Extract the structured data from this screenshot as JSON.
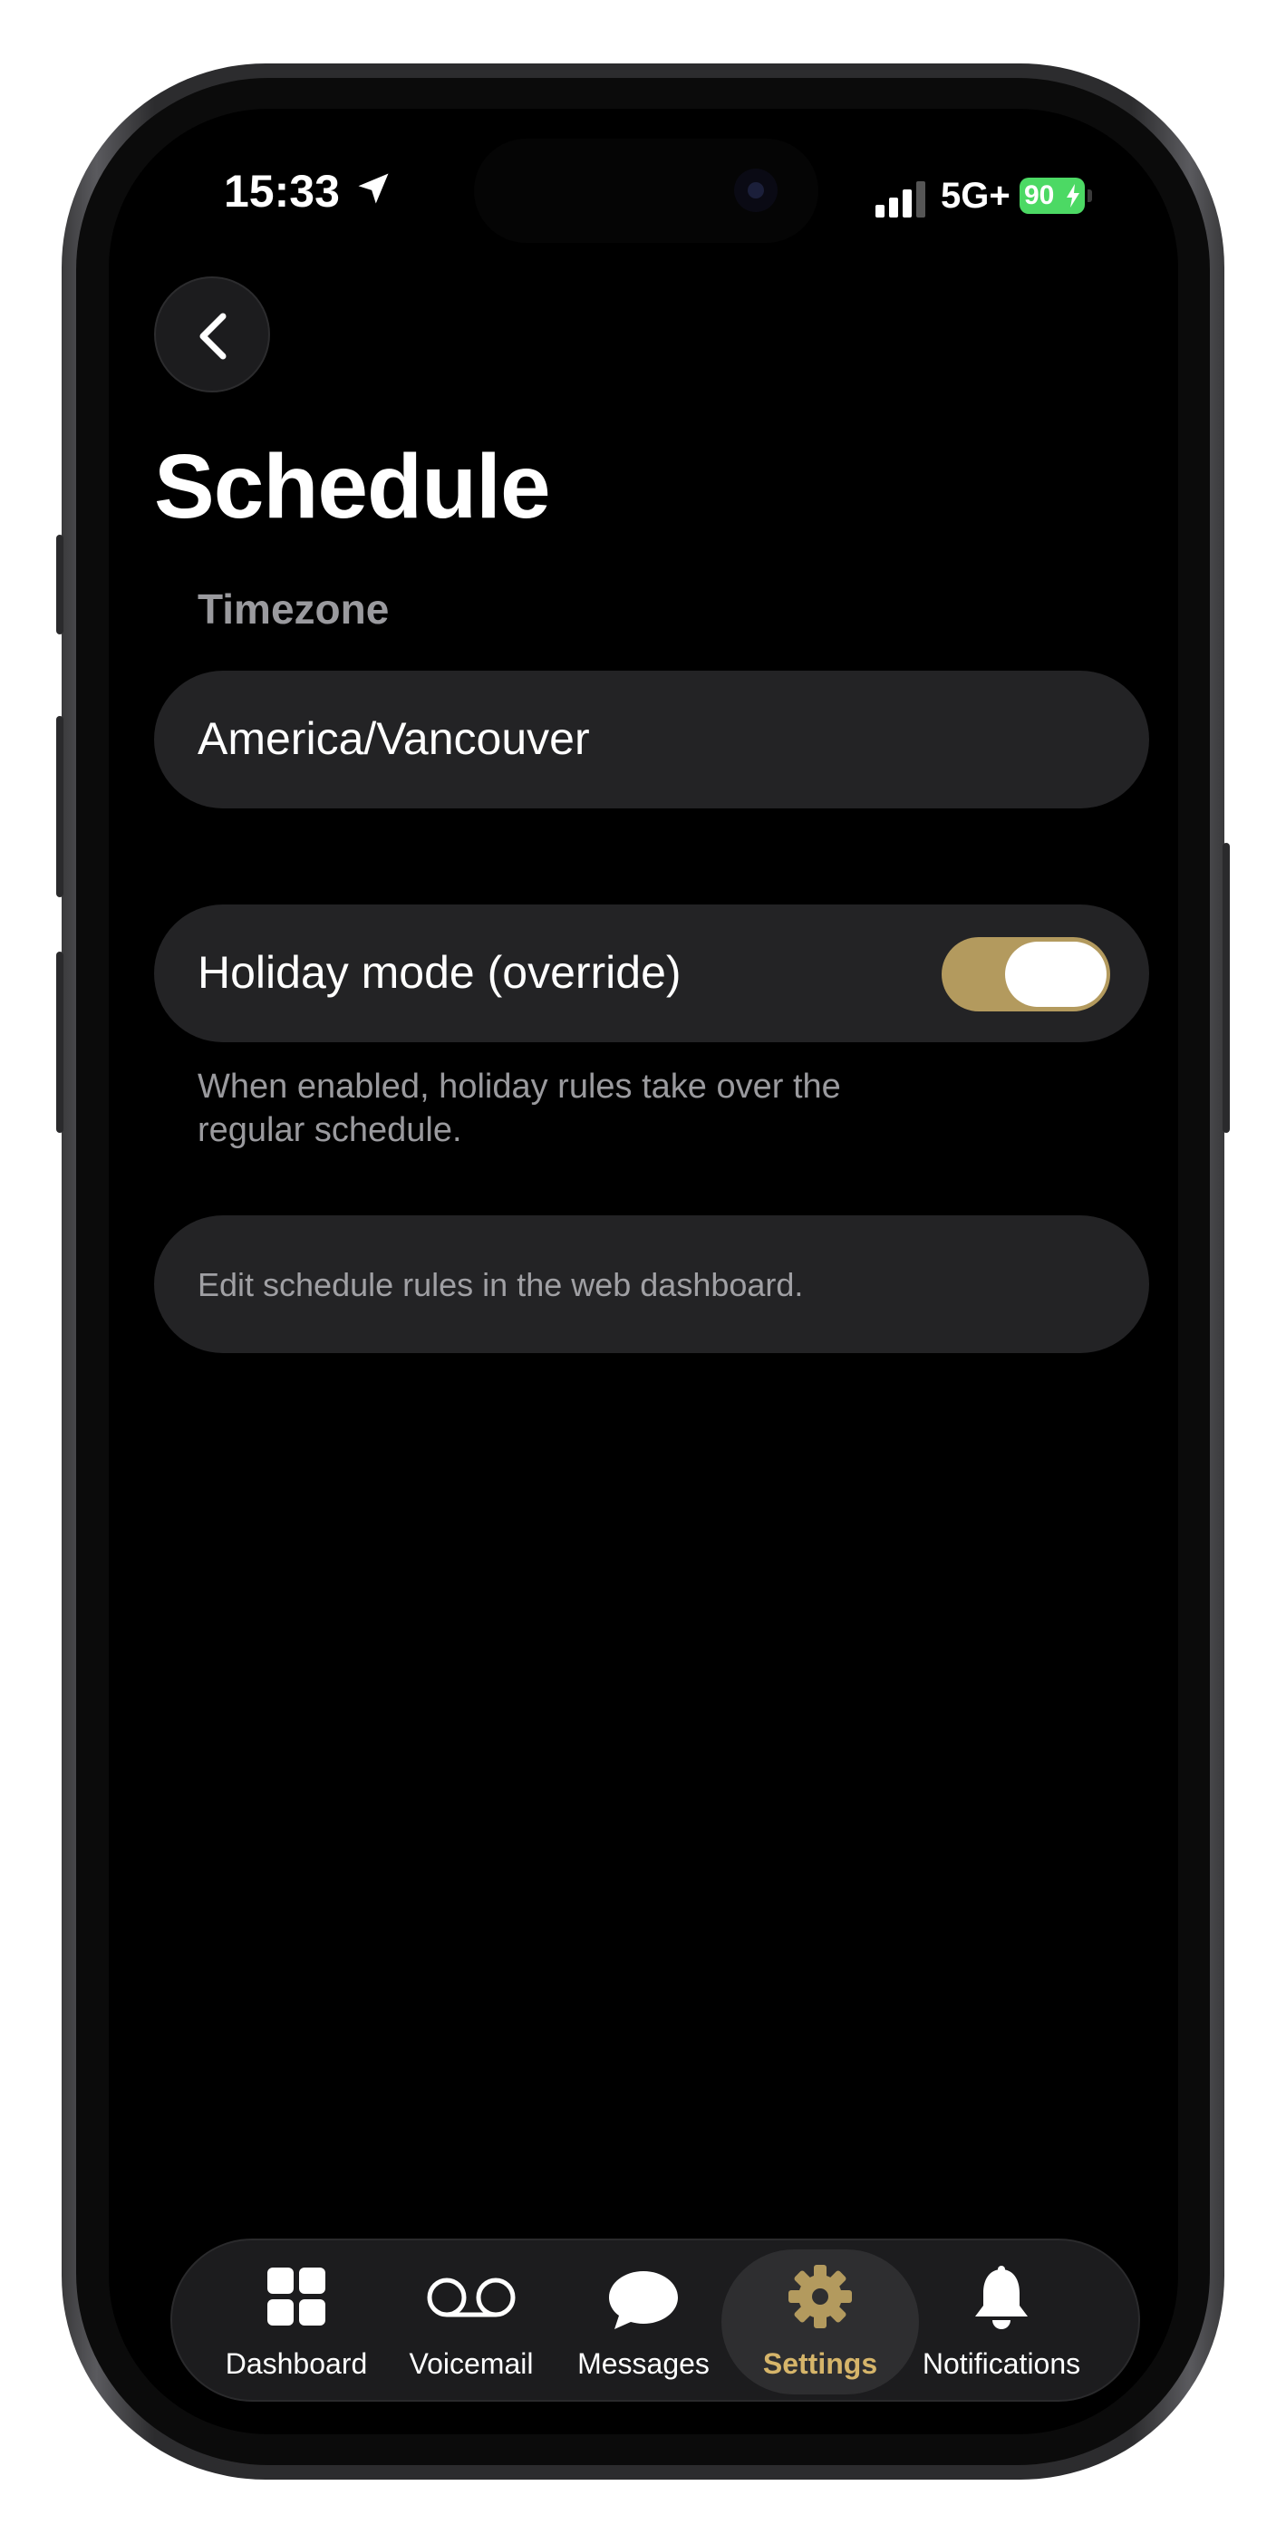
{
  "status_bar": {
    "time": "15:33",
    "network": "5G+",
    "battery": "90"
  },
  "header": {
    "title": "Schedule"
  },
  "timezone": {
    "label": "Timezone",
    "value": "America/Vancouver"
  },
  "holiday_mode": {
    "label": "Holiday mode (override)",
    "enabled": true,
    "description": "When enabled, holiday rules take over the regular schedule."
  },
  "info": {
    "text": "Edit schedule rules in the web dashboard."
  },
  "tab_bar": {
    "tabs": [
      {
        "label": "Dashboard",
        "icon": "grid-icon"
      },
      {
        "label": "Voicemail",
        "icon": "voicemail-icon"
      },
      {
        "label": "Messages",
        "icon": "chat-bubble-icon"
      },
      {
        "label": "Settings",
        "icon": "gear-icon",
        "active": true
      },
      {
        "label": "Notifications",
        "icon": "bell-icon"
      }
    ]
  },
  "colors": {
    "accent": "#d6b56a",
    "toggle_on": "#b39a5e",
    "background": "#000000",
    "card": "#232325",
    "battery": "#4cd964"
  }
}
